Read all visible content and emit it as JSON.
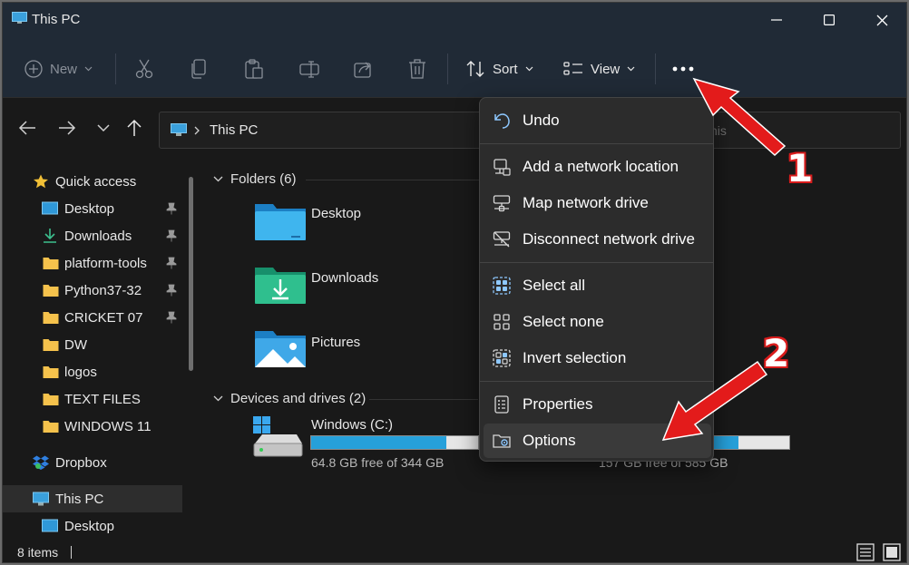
{
  "window": {
    "title": "This PC"
  },
  "toolbar": {
    "new_label": "New",
    "sort_label": "Sort",
    "view_label": "View"
  },
  "address": {
    "location": "This PC",
    "search_fragment": "his"
  },
  "sidebar": {
    "items": [
      {
        "label": "Quick access",
        "icon": "star-icon",
        "pinned": false
      },
      {
        "label": "Desktop",
        "icon": "desktop-icon",
        "pinned": true
      },
      {
        "label": "Downloads",
        "icon": "download-icon",
        "pinned": true
      },
      {
        "label": "platform-tools",
        "icon": "folder-icon",
        "pinned": true
      },
      {
        "label": "Python37-32",
        "icon": "folder-icon",
        "pinned": true
      },
      {
        "label": "CRICKET 07",
        "icon": "folder-icon",
        "pinned": true
      },
      {
        "label": "DW",
        "icon": "folder-icon",
        "pinned": false
      },
      {
        "label": "logos",
        "icon": "folder-icon",
        "pinned": false
      },
      {
        "label": "TEXT FILES",
        "icon": "folder-icon",
        "pinned": false
      },
      {
        "label": "WINDOWS 11",
        "icon": "folder-icon",
        "pinned": false
      },
      {
        "label": "Dropbox",
        "icon": "dropbox-icon",
        "pinned": false
      },
      {
        "label": "This PC",
        "icon": "computer-icon",
        "pinned": false
      },
      {
        "label": "Desktop",
        "icon": "desktop-icon",
        "pinned": false
      }
    ]
  },
  "content": {
    "folders_header": "Folders (6)",
    "folders": [
      {
        "label": "Desktop"
      },
      {
        "label": "Downloads"
      },
      {
        "label": "Pictures"
      }
    ],
    "drives_header": "Devices and drives (2)",
    "drives": [
      {
        "label": "Windows (C:)",
        "free_text": "64.8 GB free of 344 GB",
        "used_fraction": 0.81
      },
      {
        "label": "",
        "free_text": "157 GB free of 585 GB",
        "used_fraction": 0.73
      }
    ]
  },
  "menu": {
    "items": [
      {
        "label": "Undo",
        "icon": "undo-icon"
      },
      {
        "label": "Add a network location",
        "icon": "network-location-icon"
      },
      {
        "label": "Map network drive",
        "icon": "map-drive-icon"
      },
      {
        "label": "Disconnect network drive",
        "icon": "disconnect-drive-icon"
      },
      {
        "label": "Select all",
        "icon": "select-all-icon"
      },
      {
        "label": "Select none",
        "icon": "select-none-icon"
      },
      {
        "label": "Invert selection",
        "icon": "invert-selection-icon"
      },
      {
        "label": "Properties",
        "icon": "properties-icon"
      },
      {
        "label": "Options",
        "icon": "options-icon"
      }
    ]
  },
  "annotations": {
    "step1": "1",
    "step2": "2",
    "arrow_color": "#e31b1b"
  },
  "status": {
    "items_count": "8 items"
  },
  "colors": {
    "accent": "#26a0da",
    "titlebar": "#202a36"
  }
}
